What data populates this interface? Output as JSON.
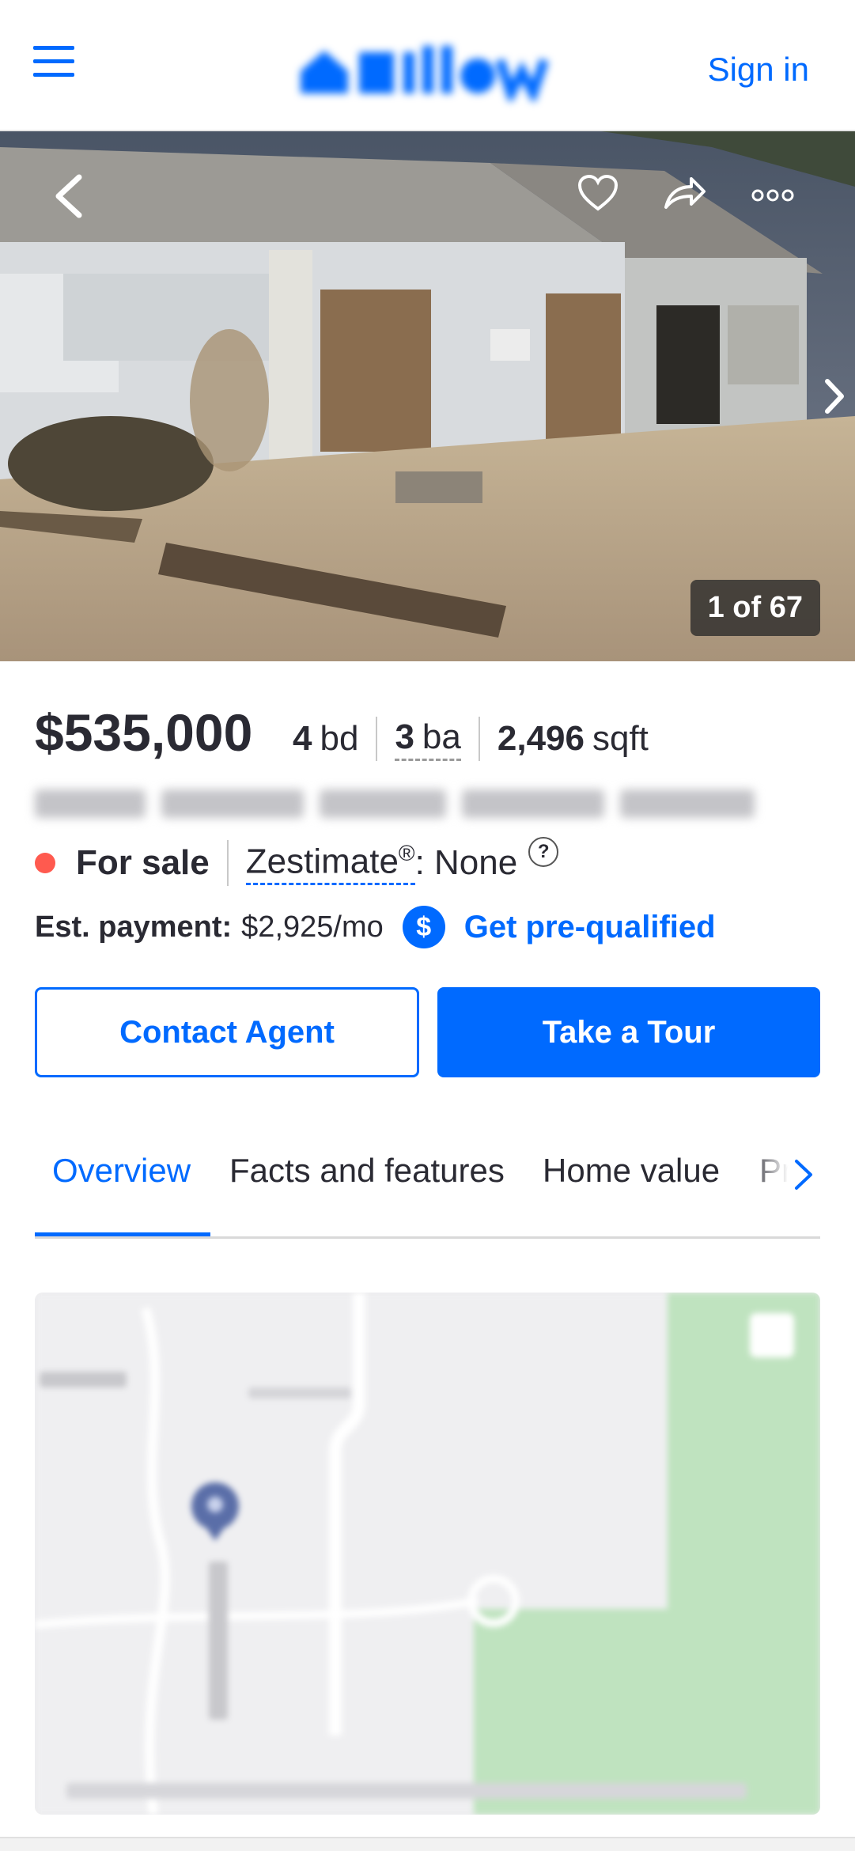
{
  "header": {
    "menu_icon": "hamburger-menu-icon",
    "logo_alt": "Zillow",
    "sign_in": "Sign in"
  },
  "photo": {
    "counter": "1 of 67",
    "icons": [
      "back-chevron-icon",
      "heart-icon",
      "share-icon",
      "more-icon",
      "next-chevron-icon"
    ]
  },
  "listing": {
    "price": "$535,000",
    "beds_value": "4",
    "beds_label": "bd",
    "baths_value": "3",
    "baths_label": "ba",
    "sqft_value": "2,496",
    "sqft_label": "sqft",
    "status": "For sale",
    "status_color": "#ff5a4f",
    "zestimate_label": "Zestimate",
    "zestimate_reg": "®",
    "zestimate_value": ": None",
    "help": "?",
    "payment_label": "Est. payment:",
    "payment_value": "$2,925/mo",
    "dollar_symbol": "$",
    "prequalify": "Get pre-qualified"
  },
  "actions": {
    "contact": "Contact Agent",
    "tour": "Take a Tour"
  },
  "tabs": [
    {
      "label": "Overview",
      "active": true
    },
    {
      "label": "Facts and features",
      "active": false
    },
    {
      "label": "Home value",
      "active": false
    },
    {
      "label": "Pr",
      "active": false
    }
  ],
  "colors": {
    "brand": "#006aff",
    "text": "#2a2a33",
    "map_green": "#bfe3bf"
  }
}
